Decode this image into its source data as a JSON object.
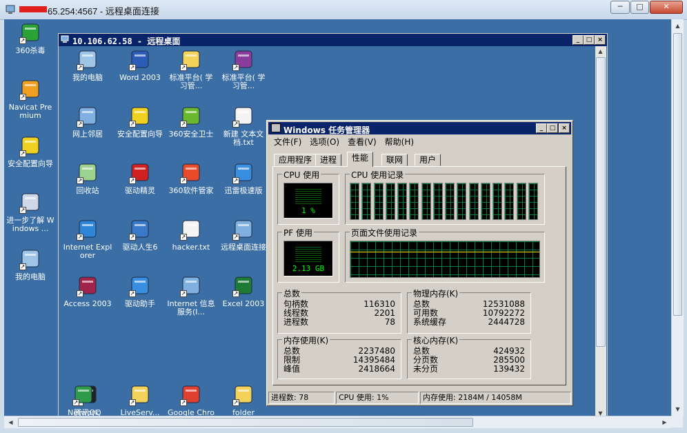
{
  "outer_window": {
    "title": "65.254:4567 - 远程桌面连接",
    "min_label": "─",
    "max_label": "□",
    "close_label": "✕"
  },
  "remote_window": {
    "title": "10.106.62.58 - 远程桌面",
    "min_label": "_",
    "max_label": "□",
    "close_label": "×"
  },
  "outer_desktop_icons": [
    {
      "label": "360杀毒",
      "icon": "shield-icon",
      "color": "#2aa336"
    },
    {
      "label": "Navicat Premium",
      "icon": "navicat-icon",
      "color": "#f0a020"
    },
    {
      "label": "安全配置向导",
      "icon": "wizard-icon",
      "color": "#f0d020"
    },
    {
      "label": "进一步了解 Windows ...",
      "icon": "cd-icon",
      "color": "#cfd8e8"
    },
    {
      "label": "我的电脑",
      "icon": "computer-icon",
      "color": "#9ec4e8"
    }
  ],
  "remote_desktop_icons": [
    {
      "label": "我的电脑",
      "icon": "computer-icon",
      "color": "#9ec4e8"
    },
    {
      "label": "Word 2003",
      "icon": "word-icon",
      "color": "#2b5cb8"
    },
    {
      "label": "标准平台( 学习管...",
      "icon": "folder-icon",
      "color": "#f3d25a"
    },
    {
      "label": "标准平台( 学习管...",
      "icon": "archive-icon",
      "color": "#8a3c9c"
    },
    {
      "label": "网上邻居",
      "icon": "network-icon",
      "color": "#7fb0e0"
    },
    {
      "label": "安全配置向导",
      "icon": "wizard-icon",
      "color": "#f0d020"
    },
    {
      "label": "360安全卫士",
      "icon": "guard-icon",
      "color": "#6ab82e"
    },
    {
      "label": "新建 文本文档.txt",
      "icon": "text-file-icon",
      "color": "#f4f4f4"
    },
    {
      "label": "回收站",
      "icon": "recycle-bin-icon",
      "color": "#9bd28e"
    },
    {
      "label": "驱动精灵",
      "icon": "driver-genius-icon",
      "color": "#d02020"
    },
    {
      "label": "360软件管家",
      "icon": "software-manager-icon",
      "color": "#e84a2a"
    },
    {
      "label": "迅雷极速版",
      "icon": "thunder-icon",
      "color": "#3a8ee0"
    },
    {
      "label": "Internet Explorer",
      "icon": "ie-icon",
      "color": "#2f86d6"
    },
    {
      "label": "驱动人生6",
      "icon": "gear-icon",
      "color": "#3a78c8"
    },
    {
      "label": "hacker.txt",
      "icon": "text-file-icon",
      "color": "#f4f4f4"
    },
    {
      "label": "远程桌面连接",
      "icon": "remote-desktop-icon",
      "color": "#7fb0e0"
    },
    {
      "label": "Access 2003",
      "icon": "access-icon",
      "color": "#a0244a"
    },
    {
      "label": "驱动助手",
      "icon": "driver-helper-icon",
      "color": "#3a8ee0"
    },
    {
      "label": "Internet 信息服务(I...",
      "icon": "iis-icon",
      "color": "#7fb0e0"
    },
    {
      "label": "Excel 2003",
      "icon": "excel-icon",
      "color": "#1e7a34"
    },
    {
      "label": "腾讯QQ",
      "icon": "qq-icon",
      "color": "#222222"
    },
    {
      "label": "LiveServ...",
      "icon": "live-server-icon",
      "color": "#f3d25a"
    },
    {
      "label": "Google Chrome",
      "icon": "chrome-icon",
      "color": "#e04030"
    },
    {
      "label": "folder",
      "icon": "folder-icon",
      "color": "#f3d25a"
    },
    {
      "label": "Network",
      "icon": "globe-icon",
      "color": "#2f9a4a"
    }
  ],
  "task_manager": {
    "title": "Windows 任务管理器",
    "menu": [
      "文件(F)",
      "选项(O)",
      "查看(V)",
      "帮助(H)"
    ],
    "tabs": [
      "应用程序",
      "进程",
      "性能",
      "联网",
      "用户"
    ],
    "active_tab": "性能",
    "cpu_usage_label": "CPU 使用",
    "cpu_usage_value": "1 %",
    "cpu_history_label": "CPU 使用记录",
    "pf_usage_label": "PF 使用",
    "pf_usage_value": "2.13 GB",
    "pf_history_label": "页面文件使用记录",
    "totals": {
      "label": "总数",
      "rows": [
        {
          "k": "句柄数",
          "v": "116310"
        },
        {
          "k": "线程数",
          "v": "2201"
        },
        {
          "k": "进程数",
          "v": "78"
        }
      ]
    },
    "physical": {
      "label": "物理内存(K)",
      "rows": [
        {
          "k": "总数",
          "v": "12531088"
        },
        {
          "k": "可用数",
          "v": "10792272"
        },
        {
          "k": "系统缓存",
          "v": "2444728"
        }
      ]
    },
    "commit": {
      "label": "内存使用(K)",
      "rows": [
        {
          "k": "总数",
          "v": "2237480"
        },
        {
          "k": "限制",
          "v": "14395484"
        },
        {
          "k": "峰值",
          "v": "2418664"
        }
      ]
    },
    "kernel": {
      "label": "核心内存(K)",
      "rows": [
        {
          "k": "总数",
          "v": "424932"
        },
        {
          "k": "分页数",
          "v": "285500"
        },
        {
          "k": "未分页",
          "v": "139432"
        }
      ]
    },
    "status": {
      "processes": "进程数: 78",
      "cpu": "CPU 使用: 1%",
      "memory": "内存使用: 2184M / 14058M"
    }
  },
  "colors": {
    "desktop": "#3a6ea5",
    "titlebar": "#0a246a",
    "graph_line": "#00ff00",
    "graph_grid": "#008040"
  }
}
